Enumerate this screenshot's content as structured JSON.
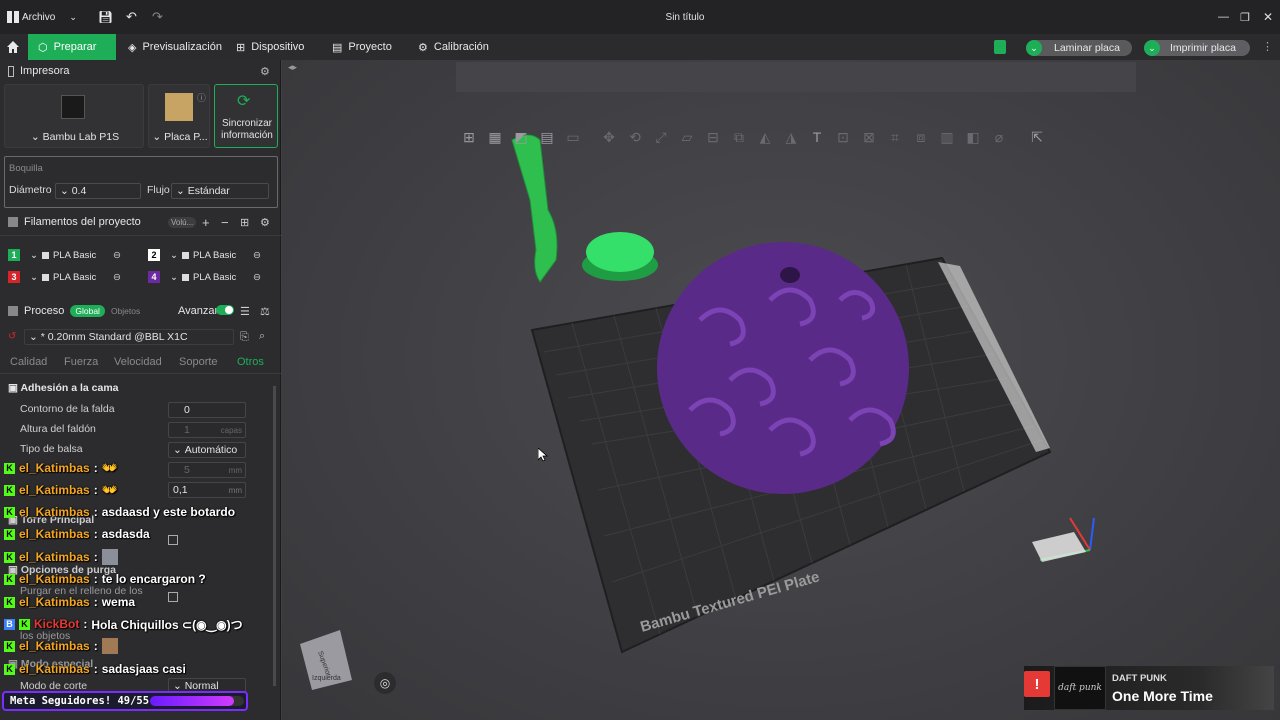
{
  "titlebar": {
    "menu_label": "Archivo",
    "title": "Sin título"
  },
  "tabs": [
    {
      "label": "Preparar",
      "icon": "prepare-icon"
    },
    {
      "label": "Previsualización",
      "icon": "layers-icon"
    },
    {
      "label": "Dispositivo",
      "icon": "device-icon"
    },
    {
      "label": "Proyecto",
      "icon": "project-icon"
    },
    {
      "label": "Calibración",
      "icon": "calibration-icon"
    }
  ],
  "actions": {
    "slice_label": "Laminar placa",
    "print_label": "Imprimir placa"
  },
  "printer": {
    "section_title": "Impresora",
    "printer_name": "Bambu Lab P1S",
    "plate_name": "Placa P...",
    "sync_label_1": "Sincronizar",
    "sync_label_2": "información"
  },
  "nozzle": {
    "title": "Boquilla",
    "diameter_label": "Diámetro",
    "diameter_value": "0.4",
    "flow_label": "Flujo",
    "flow_value": "Estándar"
  },
  "filaments": {
    "title": "Filamentos del proyecto",
    "volume_label": "Volú...",
    "items": [
      {
        "num": "1",
        "name": "PLA Basic",
        "color": "#1eae58"
      },
      {
        "num": "2",
        "name": "PLA Basic",
        "color": "#ffffff"
      },
      {
        "num": "3",
        "name": "PLA Basic",
        "color": "#d6242b"
      },
      {
        "num": "4",
        "name": "PLA Basic",
        "color": "#6b2aa0"
      }
    ]
  },
  "process": {
    "title": "Proceso",
    "global_label": "Global",
    "objects_label": "Objetos",
    "advanced_label": "Avanzar",
    "preset": "* 0.20mm Standard @BBL X1C",
    "tabs": [
      "Calidad",
      "Fuerza",
      "Velocidad",
      "Soporte",
      "Otros"
    ],
    "active_tab": "Otros",
    "group_title": "Adhesión a la cama",
    "rows": [
      {
        "label": "Contorno de la falda",
        "value": "0",
        "unit": ""
      },
      {
        "label": "Altura del faldón",
        "value": "1",
        "unit": "capas"
      },
      {
        "label": "Tipo de balsa",
        "value": "Automático",
        "unit": ""
      },
      {
        "label": "",
        "value": "5",
        "unit": "mm"
      },
      {
        "label": "",
        "value": "0,1",
        "unit": "mm"
      }
    ],
    "tower_title": "Torre Principal",
    "purge_title": "Opciones de purga",
    "purge_row": "Purgar en el relleno de los",
    "purge_row_2": "los objetos",
    "special_mode": "Modo especial",
    "cut_mode_label": "Modo de corte",
    "cut_mode_value": "Normal"
  },
  "chat": [
    {
      "user": "el_Katimbas",
      "msg": ""
    },
    {
      "user": "el_Katimbas",
      "msg": ""
    },
    {
      "user": "el_Katimbas",
      "msg": "asdaasd y este botardo"
    },
    {
      "user": "el_Katimbas",
      "msg": "asdasda"
    },
    {
      "user": "el_Katimbas",
      "msg": ""
    },
    {
      "user": "el_Katimbas",
      "msg": "te lo encargaron ?"
    },
    {
      "user": "el_Katimbas",
      "msg": "wema"
    },
    {
      "user": "KickBot",
      "msg": "Hola Chiquillos ⊂(◉‿◉)つ"
    },
    {
      "user": "el_Katimbas",
      "msg": ""
    },
    {
      "user": "el_Katimbas",
      "msg": "sadasjaas casi"
    }
  ],
  "overlay": {
    "goal_text": "Meta Seguidores! 49/55",
    "goal_progress": 0.89,
    "music_artist": "DAFT PUNK",
    "music_title": "One More Time",
    "album_text": "daft punk"
  },
  "viewport": {
    "plate_label": "Bambu Textured PEI Plate",
    "cube_face_1": "Superior",
    "cube_face_2": "Izquierda"
  }
}
